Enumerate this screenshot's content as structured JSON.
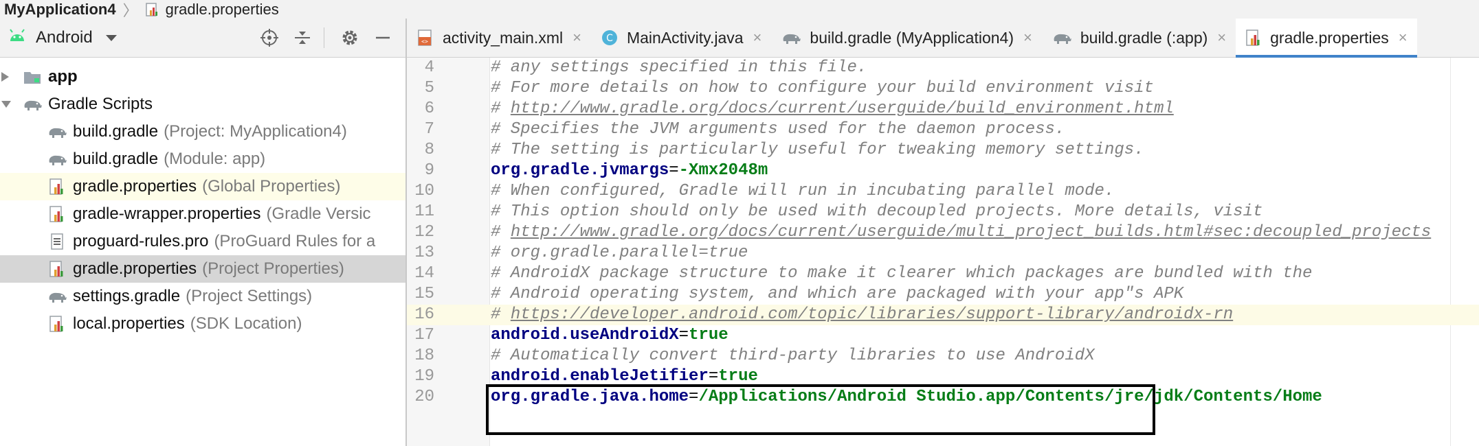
{
  "breadcrumb": {
    "project": "MyApplication4",
    "file": "gradle.properties"
  },
  "left_panel": {
    "view_selector": "Android",
    "tree": [
      {
        "label": "app",
        "hint": "",
        "bold": true,
        "state": "",
        "arrow": "collapsed",
        "icon": "folder-icon",
        "indent": 0
      },
      {
        "label": "Gradle Scripts",
        "hint": "",
        "bold": false,
        "state": "",
        "arrow": "expanded",
        "icon": "gradle-elephant-icon",
        "indent": 0
      },
      {
        "label": "build.gradle",
        "hint": "(Project: MyApplication4)",
        "bold": false,
        "state": "",
        "icon": "gradle-elephant-icon",
        "indent": 1
      },
      {
        "label": "build.gradle",
        "hint": "(Module: app)",
        "bold": false,
        "state": "",
        "icon": "gradle-elephant-icon",
        "indent": 1
      },
      {
        "label": "gradle.properties",
        "hint": "(Global Properties)",
        "bold": false,
        "state": "highlight",
        "icon": "properties-file-icon",
        "indent": 1
      },
      {
        "label": "gradle-wrapper.properties",
        "hint": "(Gradle Versic",
        "bold": false,
        "state": "",
        "icon": "properties-file-icon",
        "indent": 1
      },
      {
        "label": "proguard-rules.pro",
        "hint": "(ProGuard Rules for a",
        "bold": false,
        "state": "",
        "icon": "text-file-icon",
        "indent": 1
      },
      {
        "label": "gradle.properties",
        "hint": "(Project Properties)",
        "bold": false,
        "state": "selected",
        "icon": "properties-file-icon",
        "indent": 1
      },
      {
        "label": "settings.gradle",
        "hint": "(Project Settings)",
        "bold": false,
        "state": "",
        "icon": "gradle-elephant-icon",
        "indent": 1
      },
      {
        "label": "local.properties",
        "hint": "(SDK Location)",
        "bold": false,
        "state": "",
        "icon": "properties-file-icon",
        "indent": 1
      }
    ]
  },
  "tabs": [
    {
      "label": "activity_main.xml",
      "icon": "xml-file-icon",
      "active": false
    },
    {
      "label": "MainActivity.java",
      "icon": "java-class-icon",
      "active": false
    },
    {
      "label": "build.gradle (MyApplication4)",
      "icon": "gradle-elephant-icon",
      "active": false
    },
    {
      "label": "build.gradle (:app)",
      "icon": "gradle-elephant-icon",
      "active": false
    },
    {
      "label": "gradle.properties",
      "icon": "properties-file-icon",
      "active": true
    }
  ],
  "tab_close_glyph": "×",
  "editor": {
    "current_line": 16,
    "lines": [
      {
        "n": "4",
        "parts": [
          [
            "c",
            "# any settings specified in this file."
          ]
        ]
      },
      {
        "n": "5",
        "parts": [
          [
            "c",
            "# For more details on how to configure your build environment visit"
          ]
        ]
      },
      {
        "n": "6",
        "parts": [
          [
            "c",
            "# "
          ],
          [
            "u",
            "http://www.gradle.org/docs/current/userguide/build_environment.html"
          ]
        ]
      },
      {
        "n": "7",
        "parts": [
          [
            "c",
            "# Specifies the JVM arguments used for the daemon process."
          ]
        ]
      },
      {
        "n": "8",
        "parts": [
          [
            "c",
            "# The setting is particularly useful for tweaking memory settings."
          ]
        ]
      },
      {
        "n": "9",
        "parts": [
          [
            "k",
            "org.gradle.jvmargs"
          ],
          [
            "eq",
            "="
          ],
          [
            "v",
            "-Xmx2048m"
          ]
        ]
      },
      {
        "n": "10",
        "parts": [
          [
            "c",
            "# When configured, Gradle will run in incubating parallel mode."
          ]
        ]
      },
      {
        "n": "11",
        "parts": [
          [
            "c",
            "# This option should only be used with decoupled projects. More details, visit"
          ]
        ]
      },
      {
        "n": "12",
        "parts": [
          [
            "c",
            "# "
          ],
          [
            "u",
            "http://www.gradle.org/docs/current/userguide/multi_project_builds.html#sec:decoupled_projects"
          ]
        ]
      },
      {
        "n": "13",
        "parts": [
          [
            "c",
            "# org.gradle.parallel=true"
          ]
        ]
      },
      {
        "n": "14",
        "parts": [
          [
            "c",
            "# AndroidX package structure to make it clearer which packages are bundled with the"
          ]
        ]
      },
      {
        "n": "15",
        "parts": [
          [
            "c",
            "# Android operating system, and which are packaged with your app\"s APK"
          ]
        ]
      },
      {
        "n": "16",
        "parts": [
          [
            "c",
            "# "
          ],
          [
            "u",
            "https://developer.android.com/topic/libraries/support-library/androidx-rn"
          ]
        ]
      },
      {
        "n": "17",
        "parts": [
          [
            "k",
            "android.useAndroidX"
          ],
          [
            "eq",
            "="
          ],
          [
            "v",
            "true"
          ]
        ]
      },
      {
        "n": "18",
        "parts": [
          [
            "c",
            "# Automatically convert third-party libraries to use AndroidX"
          ]
        ]
      },
      {
        "n": "19",
        "parts": [
          [
            "k",
            "android.enableJetifier"
          ],
          [
            "eq",
            "="
          ],
          [
            "v",
            "true"
          ]
        ]
      },
      {
        "n": "20",
        "parts": [
          [
            "k",
            "org.gradle.java.home"
          ],
          [
            "eq",
            "="
          ],
          [
            "v",
            "/Applications/Android Studio.app/Contents/jre/jdk/Contents/Home"
          ]
        ]
      }
    ]
  },
  "colors": {
    "accent": "#4083c9",
    "comment": "#808080",
    "key": "#000080",
    "value": "#067d17",
    "selection": "#d6d6d6",
    "highlight": "#fefde8"
  }
}
